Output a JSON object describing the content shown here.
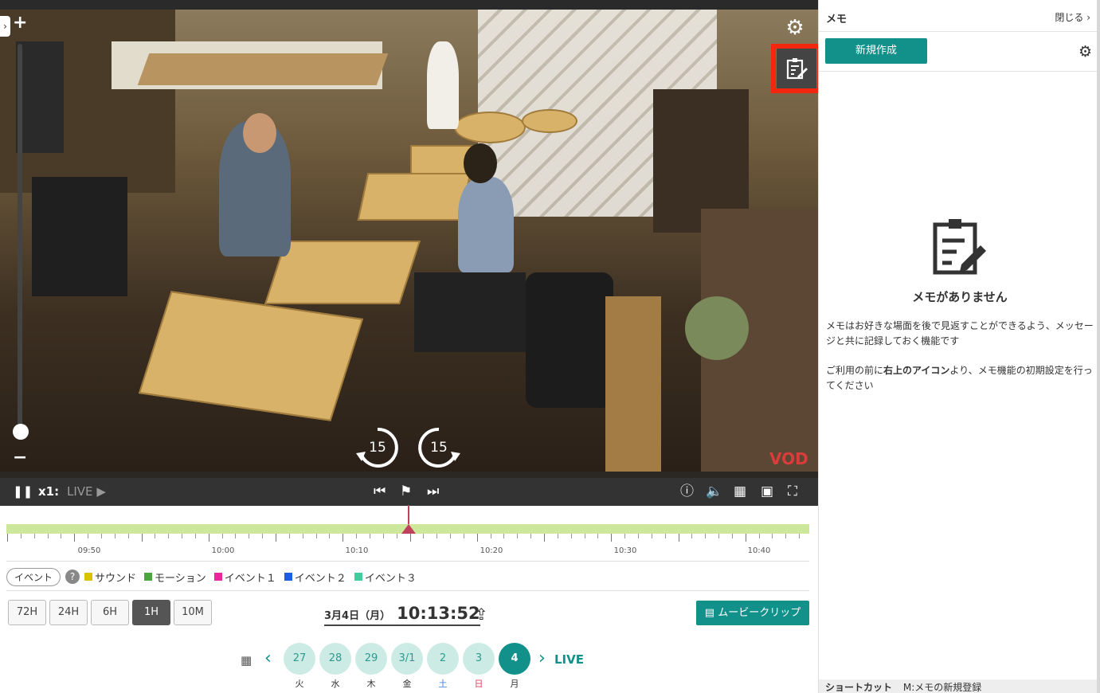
{
  "video": {
    "zoom_in": "+",
    "zoom_out": "−",
    "skip_back": "15",
    "skip_forward": "15",
    "watermark": "VOD"
  },
  "controls": {
    "speed": "x1:",
    "live_label": "LIVE"
  },
  "timeline": {
    "labels": [
      "09:50",
      "10:00",
      "10:10",
      "10:20",
      "10:30",
      "10:40"
    ]
  },
  "legend": {
    "button": "イベント",
    "help": "?",
    "items": [
      {
        "label": "サウンド",
        "color": "#d8c400"
      },
      {
        "label": "モーション",
        "color": "#4aa63c"
      },
      {
        "label": "イベント１",
        "color": "#e8289a"
      },
      {
        "label": "イベント２",
        "color": "#1a5fe0"
      },
      {
        "label": "イベント３",
        "color": "#3fcf9e"
      }
    ]
  },
  "ranges": [
    {
      "label": "72H",
      "active": false
    },
    {
      "label": "24H",
      "active": false
    },
    {
      "label": "6H",
      "active": false
    },
    {
      "label": "1H",
      "active": true
    },
    {
      "label": "10M",
      "active": false
    }
  ],
  "datetime": {
    "date": "3月4日（月）",
    "time": "10:13:52"
  },
  "clip_button": "ムービークリップ",
  "days": [
    {
      "num": "27",
      "dow": "火",
      "type": "",
      "selected": false
    },
    {
      "num": "28",
      "dow": "水",
      "type": "",
      "selected": false
    },
    {
      "num": "29",
      "dow": "木",
      "type": "",
      "selected": false
    },
    {
      "num": "3/1",
      "dow": "金",
      "type": "",
      "selected": false
    },
    {
      "num": "2",
      "dow": "土",
      "type": "sat",
      "selected": false
    },
    {
      "num": "3",
      "dow": "日",
      "type": "sun",
      "selected": false
    },
    {
      "num": "4",
      "dow": "月",
      "type": "",
      "selected": true
    }
  ],
  "day_nav": {
    "live": "LIVE"
  },
  "memo": {
    "title": "メモ",
    "close": "閉じる",
    "new_button": "新規作成",
    "empty_title": "メモがありません",
    "empty_desc": "メモはお好きな場面を後で見返すことができるよう、メッセージと共に記録しておく機能です",
    "note_prefix": "ご利用の前に",
    "note_bold": "右上のアイコン",
    "note_suffix": "より、メモ機能の初期設定を行ってください",
    "shortcut_label": "ショートカット",
    "shortcut_value": "M:メモの新規登録"
  },
  "colors": {
    "accent": "#12918a",
    "highlight": "#f5260f",
    "timeline_fill": "#cde89b",
    "playhead": "#c0415d"
  }
}
